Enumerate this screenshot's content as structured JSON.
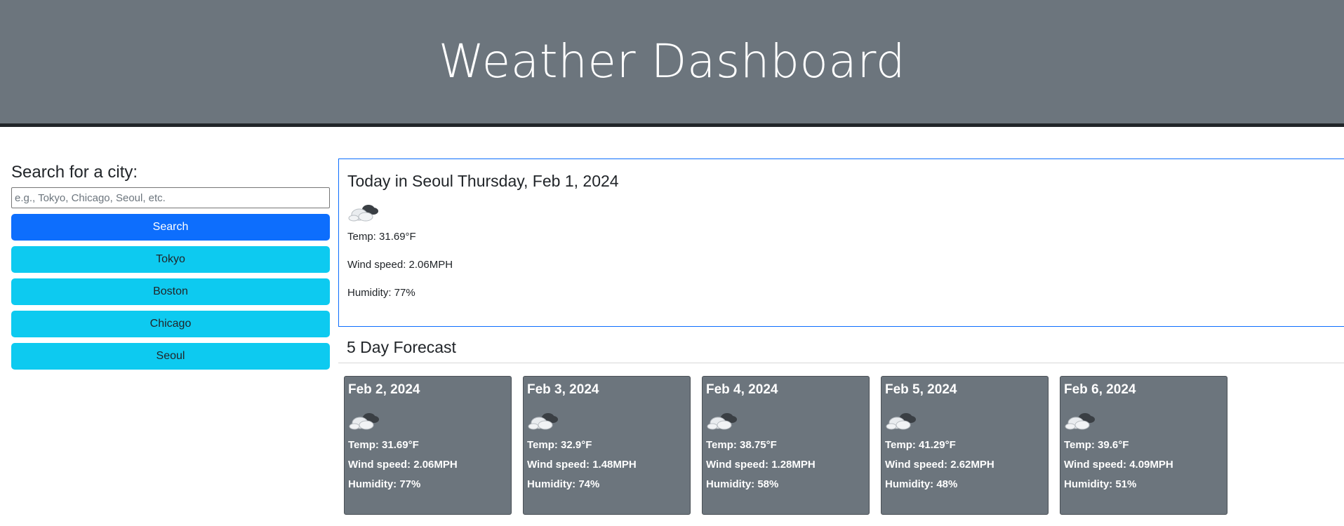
{
  "header": {
    "title": "Weather Dashboard"
  },
  "sidebar": {
    "heading": "Search for a city:",
    "search_placeholder": "e.g., Tokyo, Chicago, Seoul, etc.",
    "search_value": "",
    "search_label": "Search",
    "history": [
      "Tokyo",
      "Boston",
      "Chicago",
      "Seoul"
    ]
  },
  "today": {
    "title": "Today in Seoul Thursday, Feb 1, 2024",
    "icon": "partly-cloudy-icon",
    "temp": "Temp: 31.69°F",
    "wind": "Wind speed: 2.06MPH",
    "humidity": "Humidity: 77%"
  },
  "forecast": {
    "title": "5 Day Forecast",
    "days": [
      {
        "date": "Feb 2, 2024",
        "icon": "partly-cloudy-icon",
        "temp": "Temp: 31.69°F",
        "wind": "Wind speed: 2.06MPH",
        "humidity": "Humidity: 77%"
      },
      {
        "date": "Feb 3, 2024",
        "icon": "partly-cloudy-icon",
        "temp": "Temp: 32.9°F",
        "wind": "Wind speed: 1.48MPH",
        "humidity": "Humidity: 74%"
      },
      {
        "date": "Feb 4, 2024",
        "icon": "partly-cloudy-icon",
        "temp": "Temp: 38.75°F",
        "wind": "Wind speed: 1.28MPH",
        "humidity": "Humidity: 58%"
      },
      {
        "date": "Feb 5, 2024",
        "icon": "partly-cloudy-icon",
        "temp": "Temp: 41.29°F",
        "wind": "Wind speed: 2.62MPH",
        "humidity": "Humidity: 48%"
      },
      {
        "date": "Feb 6, 2024",
        "icon": "partly-cloudy-icon",
        "temp": "Temp: 39.6°F",
        "wind": "Wind speed: 4.09MPH",
        "humidity": "Humidity: 51%"
      }
    ]
  },
  "colors": {
    "header_bg": "#6c757d",
    "primary": "#0d6efd",
    "info": "#0dcaf0",
    "card_bg": "#6c757d"
  }
}
